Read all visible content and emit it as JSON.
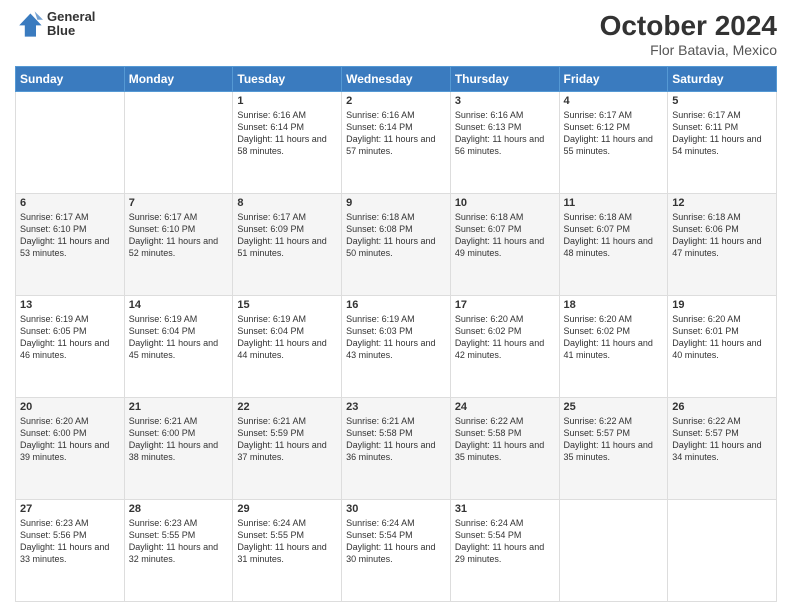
{
  "header": {
    "logo_line1": "General",
    "logo_line2": "Blue",
    "title": "October 2024",
    "subtitle": "Flor Batavia, Mexico"
  },
  "days_of_week": [
    "Sunday",
    "Monday",
    "Tuesday",
    "Wednesday",
    "Thursday",
    "Friday",
    "Saturday"
  ],
  "weeks": [
    [
      {
        "day": "",
        "info": ""
      },
      {
        "day": "",
        "info": ""
      },
      {
        "day": "1",
        "info": "Sunrise: 6:16 AM\nSunset: 6:14 PM\nDaylight: 11 hours and 58 minutes."
      },
      {
        "day": "2",
        "info": "Sunrise: 6:16 AM\nSunset: 6:14 PM\nDaylight: 11 hours and 57 minutes."
      },
      {
        "day": "3",
        "info": "Sunrise: 6:16 AM\nSunset: 6:13 PM\nDaylight: 11 hours and 56 minutes."
      },
      {
        "day": "4",
        "info": "Sunrise: 6:17 AM\nSunset: 6:12 PM\nDaylight: 11 hours and 55 minutes."
      },
      {
        "day": "5",
        "info": "Sunrise: 6:17 AM\nSunset: 6:11 PM\nDaylight: 11 hours and 54 minutes."
      }
    ],
    [
      {
        "day": "6",
        "info": "Sunrise: 6:17 AM\nSunset: 6:10 PM\nDaylight: 11 hours and 53 minutes."
      },
      {
        "day": "7",
        "info": "Sunrise: 6:17 AM\nSunset: 6:10 PM\nDaylight: 11 hours and 52 minutes."
      },
      {
        "day": "8",
        "info": "Sunrise: 6:17 AM\nSunset: 6:09 PM\nDaylight: 11 hours and 51 minutes."
      },
      {
        "day": "9",
        "info": "Sunrise: 6:18 AM\nSunset: 6:08 PM\nDaylight: 11 hours and 50 minutes."
      },
      {
        "day": "10",
        "info": "Sunrise: 6:18 AM\nSunset: 6:07 PM\nDaylight: 11 hours and 49 minutes."
      },
      {
        "day": "11",
        "info": "Sunrise: 6:18 AM\nSunset: 6:07 PM\nDaylight: 11 hours and 48 minutes."
      },
      {
        "day": "12",
        "info": "Sunrise: 6:18 AM\nSunset: 6:06 PM\nDaylight: 11 hours and 47 minutes."
      }
    ],
    [
      {
        "day": "13",
        "info": "Sunrise: 6:19 AM\nSunset: 6:05 PM\nDaylight: 11 hours and 46 minutes."
      },
      {
        "day": "14",
        "info": "Sunrise: 6:19 AM\nSunset: 6:04 PM\nDaylight: 11 hours and 45 minutes."
      },
      {
        "day": "15",
        "info": "Sunrise: 6:19 AM\nSunset: 6:04 PM\nDaylight: 11 hours and 44 minutes."
      },
      {
        "day": "16",
        "info": "Sunrise: 6:19 AM\nSunset: 6:03 PM\nDaylight: 11 hours and 43 minutes."
      },
      {
        "day": "17",
        "info": "Sunrise: 6:20 AM\nSunset: 6:02 PM\nDaylight: 11 hours and 42 minutes."
      },
      {
        "day": "18",
        "info": "Sunrise: 6:20 AM\nSunset: 6:02 PM\nDaylight: 11 hours and 41 minutes."
      },
      {
        "day": "19",
        "info": "Sunrise: 6:20 AM\nSunset: 6:01 PM\nDaylight: 11 hours and 40 minutes."
      }
    ],
    [
      {
        "day": "20",
        "info": "Sunrise: 6:20 AM\nSunset: 6:00 PM\nDaylight: 11 hours and 39 minutes."
      },
      {
        "day": "21",
        "info": "Sunrise: 6:21 AM\nSunset: 6:00 PM\nDaylight: 11 hours and 38 minutes."
      },
      {
        "day": "22",
        "info": "Sunrise: 6:21 AM\nSunset: 5:59 PM\nDaylight: 11 hours and 37 minutes."
      },
      {
        "day": "23",
        "info": "Sunrise: 6:21 AM\nSunset: 5:58 PM\nDaylight: 11 hours and 36 minutes."
      },
      {
        "day": "24",
        "info": "Sunrise: 6:22 AM\nSunset: 5:58 PM\nDaylight: 11 hours and 35 minutes."
      },
      {
        "day": "25",
        "info": "Sunrise: 6:22 AM\nSunset: 5:57 PM\nDaylight: 11 hours and 35 minutes."
      },
      {
        "day": "26",
        "info": "Sunrise: 6:22 AM\nSunset: 5:57 PM\nDaylight: 11 hours and 34 minutes."
      }
    ],
    [
      {
        "day": "27",
        "info": "Sunrise: 6:23 AM\nSunset: 5:56 PM\nDaylight: 11 hours and 33 minutes."
      },
      {
        "day": "28",
        "info": "Sunrise: 6:23 AM\nSunset: 5:55 PM\nDaylight: 11 hours and 32 minutes."
      },
      {
        "day": "29",
        "info": "Sunrise: 6:24 AM\nSunset: 5:55 PM\nDaylight: 11 hours and 31 minutes."
      },
      {
        "day": "30",
        "info": "Sunrise: 6:24 AM\nSunset: 5:54 PM\nDaylight: 11 hours and 30 minutes."
      },
      {
        "day": "31",
        "info": "Sunrise: 6:24 AM\nSunset: 5:54 PM\nDaylight: 11 hours and 29 minutes."
      },
      {
        "day": "",
        "info": ""
      },
      {
        "day": "",
        "info": ""
      }
    ]
  ]
}
